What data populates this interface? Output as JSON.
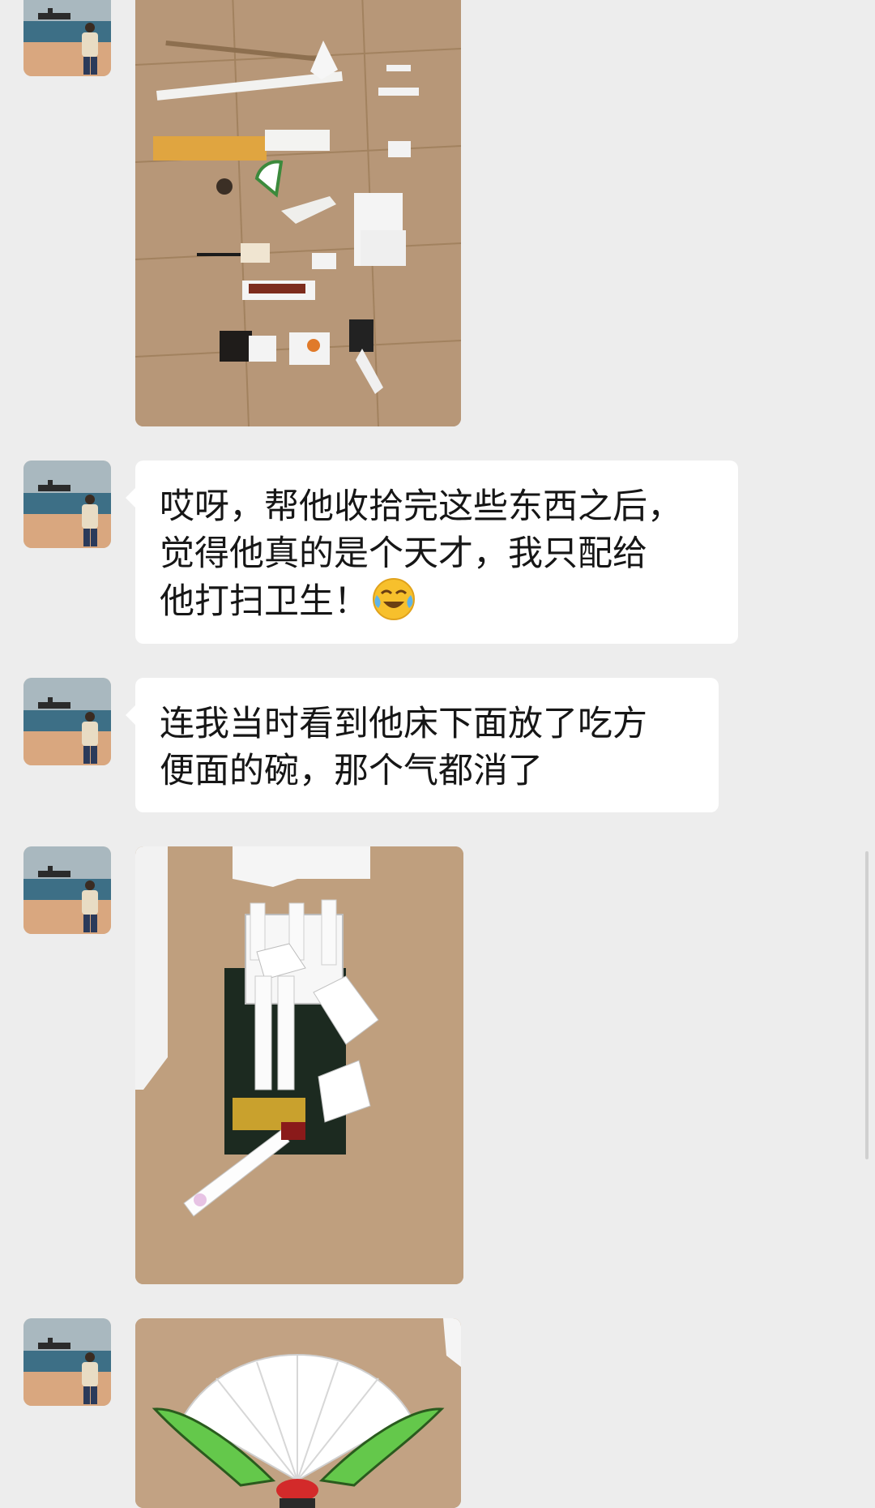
{
  "chat": {
    "messages": [
      {
        "type": "image",
        "image_alt": "folded paper objects on wooden floor"
      },
      {
        "type": "text",
        "lines": [
          "哎呀，帮他收拾完这些东西之后，",
          "觉得他真的是个天才，我只配给",
          "他打扫卫生！"
        ],
        "emoji": "crying-laughing"
      },
      {
        "type": "text",
        "lines": [
          "连我当时看到他床下面放了吃方",
          "便面的碗，那个气都消了"
        ]
      },
      {
        "type": "image",
        "image_alt": "paper robot sculpture on box"
      },
      {
        "type": "image",
        "image_alt": "paper folding fan with green edges"
      }
    ]
  },
  "colors": {
    "background": "#ededed",
    "bubble": "#ffffff",
    "text": "#161616"
  }
}
